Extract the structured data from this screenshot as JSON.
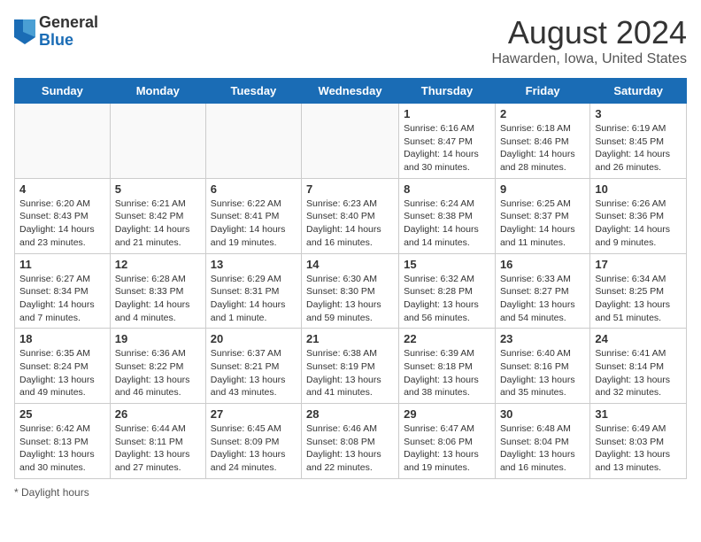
{
  "logo": {
    "general": "General",
    "blue": "Blue"
  },
  "title": "August 2024",
  "location": "Hawarden, Iowa, United States",
  "days_of_week": [
    "Sunday",
    "Monday",
    "Tuesday",
    "Wednesday",
    "Thursday",
    "Friday",
    "Saturday"
  ],
  "weeks": [
    [
      {
        "day": "",
        "info": ""
      },
      {
        "day": "",
        "info": ""
      },
      {
        "day": "",
        "info": ""
      },
      {
        "day": "",
        "info": ""
      },
      {
        "day": "1",
        "info": "Sunrise: 6:16 AM\nSunset: 8:47 PM\nDaylight: 14 hours and 30 minutes."
      },
      {
        "day": "2",
        "info": "Sunrise: 6:18 AM\nSunset: 8:46 PM\nDaylight: 14 hours and 28 minutes."
      },
      {
        "day": "3",
        "info": "Sunrise: 6:19 AM\nSunset: 8:45 PM\nDaylight: 14 hours and 26 minutes."
      }
    ],
    [
      {
        "day": "4",
        "info": "Sunrise: 6:20 AM\nSunset: 8:43 PM\nDaylight: 14 hours and 23 minutes."
      },
      {
        "day": "5",
        "info": "Sunrise: 6:21 AM\nSunset: 8:42 PM\nDaylight: 14 hours and 21 minutes."
      },
      {
        "day": "6",
        "info": "Sunrise: 6:22 AM\nSunset: 8:41 PM\nDaylight: 14 hours and 19 minutes."
      },
      {
        "day": "7",
        "info": "Sunrise: 6:23 AM\nSunset: 8:40 PM\nDaylight: 14 hours and 16 minutes."
      },
      {
        "day": "8",
        "info": "Sunrise: 6:24 AM\nSunset: 8:38 PM\nDaylight: 14 hours and 14 minutes."
      },
      {
        "day": "9",
        "info": "Sunrise: 6:25 AM\nSunset: 8:37 PM\nDaylight: 14 hours and 11 minutes."
      },
      {
        "day": "10",
        "info": "Sunrise: 6:26 AM\nSunset: 8:36 PM\nDaylight: 14 hours and 9 minutes."
      }
    ],
    [
      {
        "day": "11",
        "info": "Sunrise: 6:27 AM\nSunset: 8:34 PM\nDaylight: 14 hours and 7 minutes."
      },
      {
        "day": "12",
        "info": "Sunrise: 6:28 AM\nSunset: 8:33 PM\nDaylight: 14 hours and 4 minutes."
      },
      {
        "day": "13",
        "info": "Sunrise: 6:29 AM\nSunset: 8:31 PM\nDaylight: 14 hours and 1 minute."
      },
      {
        "day": "14",
        "info": "Sunrise: 6:30 AM\nSunset: 8:30 PM\nDaylight: 13 hours and 59 minutes."
      },
      {
        "day": "15",
        "info": "Sunrise: 6:32 AM\nSunset: 8:28 PM\nDaylight: 13 hours and 56 minutes."
      },
      {
        "day": "16",
        "info": "Sunrise: 6:33 AM\nSunset: 8:27 PM\nDaylight: 13 hours and 54 minutes."
      },
      {
        "day": "17",
        "info": "Sunrise: 6:34 AM\nSunset: 8:25 PM\nDaylight: 13 hours and 51 minutes."
      }
    ],
    [
      {
        "day": "18",
        "info": "Sunrise: 6:35 AM\nSunset: 8:24 PM\nDaylight: 13 hours and 49 minutes."
      },
      {
        "day": "19",
        "info": "Sunrise: 6:36 AM\nSunset: 8:22 PM\nDaylight: 13 hours and 46 minutes."
      },
      {
        "day": "20",
        "info": "Sunrise: 6:37 AM\nSunset: 8:21 PM\nDaylight: 13 hours and 43 minutes."
      },
      {
        "day": "21",
        "info": "Sunrise: 6:38 AM\nSunset: 8:19 PM\nDaylight: 13 hours and 41 minutes."
      },
      {
        "day": "22",
        "info": "Sunrise: 6:39 AM\nSunset: 8:18 PM\nDaylight: 13 hours and 38 minutes."
      },
      {
        "day": "23",
        "info": "Sunrise: 6:40 AM\nSunset: 8:16 PM\nDaylight: 13 hours and 35 minutes."
      },
      {
        "day": "24",
        "info": "Sunrise: 6:41 AM\nSunset: 8:14 PM\nDaylight: 13 hours and 32 minutes."
      }
    ],
    [
      {
        "day": "25",
        "info": "Sunrise: 6:42 AM\nSunset: 8:13 PM\nDaylight: 13 hours and 30 minutes."
      },
      {
        "day": "26",
        "info": "Sunrise: 6:44 AM\nSunset: 8:11 PM\nDaylight: 13 hours and 27 minutes."
      },
      {
        "day": "27",
        "info": "Sunrise: 6:45 AM\nSunset: 8:09 PM\nDaylight: 13 hours and 24 minutes."
      },
      {
        "day": "28",
        "info": "Sunrise: 6:46 AM\nSunset: 8:08 PM\nDaylight: 13 hours and 22 minutes."
      },
      {
        "day": "29",
        "info": "Sunrise: 6:47 AM\nSunset: 8:06 PM\nDaylight: 13 hours and 19 minutes."
      },
      {
        "day": "30",
        "info": "Sunrise: 6:48 AM\nSunset: 8:04 PM\nDaylight: 13 hours and 16 minutes."
      },
      {
        "day": "31",
        "info": "Sunrise: 6:49 AM\nSunset: 8:03 PM\nDaylight: 13 hours and 13 minutes."
      }
    ]
  ],
  "footer": "Daylight hours"
}
